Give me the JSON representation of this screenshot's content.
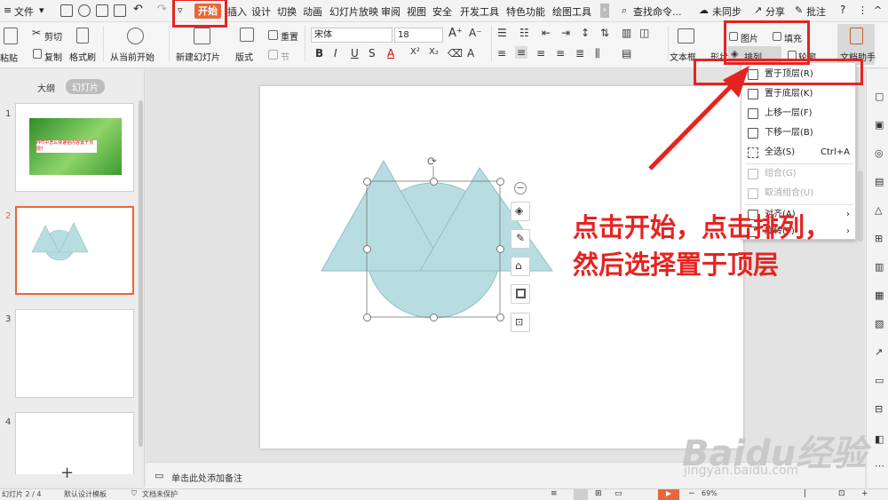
{
  "menubar": {
    "file": "文件",
    "tabs": [
      "开始",
      "插入",
      "设计",
      "切换",
      "动画",
      "幻灯片放映",
      "审阅",
      "视图",
      "安全",
      "开发工具",
      "特色功能",
      "绘图工具"
    ],
    "search": "查找命令...",
    "sync": "未同步",
    "share": "分享",
    "comment": "批注"
  },
  "ribbon": {
    "paste": "粘贴",
    "cut": "剪切",
    "copy": "复制",
    "format_painter": "格式刷",
    "from_current": "从当前开始",
    "new_slide": "新建幻灯片",
    "layout": "版式",
    "reset": "重置",
    "section": "节",
    "font": "宋体",
    "font_size": "18",
    "textbox": "文本框",
    "shape": "形状",
    "arrange": "排列",
    "picture": "图片",
    "fill": "填充",
    "outline": "轮廓",
    "doc_helper": "文档助手"
  },
  "leftpanel": {
    "outline_tab": "大纲",
    "slides_tab": "幻灯片",
    "slide_numbers": [
      "1",
      "2",
      "3",
      "4"
    ],
    "slide1_title": "PPT中怎么快速把内容置于顶层？"
  },
  "dropdown": {
    "items": [
      {
        "label": "置于顶层(R)",
        "shortcut": "",
        "disabled": false
      },
      {
        "label": "置于底层(K)",
        "shortcut": "",
        "disabled": false
      },
      {
        "label": "上移一层(F)",
        "shortcut": "",
        "disabled": false
      },
      {
        "label": "下移一层(B)",
        "shortcut": "",
        "disabled": false
      },
      {
        "label": "全选(S)",
        "shortcut": "Ctrl+A",
        "disabled": false
      },
      {
        "label": "组合(G)",
        "shortcut": "",
        "disabled": true
      },
      {
        "label": "取消组合(U)",
        "shortcut": "",
        "disabled": true
      },
      {
        "label": "对齐(A)",
        "shortcut": "",
        "disabled": false
      },
      {
        "label": "旋转(P)",
        "shortcut": "",
        "disabled": false
      }
    ]
  },
  "annotation": {
    "line1": "点击开始，点击排列，",
    "line2": "然后选择置于顶层"
  },
  "notes": {
    "placeholder": "单击此处添加备注"
  },
  "statusbar": {
    "slide_info": "幻灯片 2 / 4",
    "template": "默认设计模板",
    "protect": "文档未保护",
    "zoom": "69%"
  },
  "watermark": {
    "brand": "Baidu经验",
    "url": "jingyan.baidu.com"
  },
  "colors": {
    "accent": "#e8673a",
    "annotation_red": "#e52421",
    "shape_fill": "#b7dde1",
    "shape_stroke": "#8fbfc5"
  }
}
